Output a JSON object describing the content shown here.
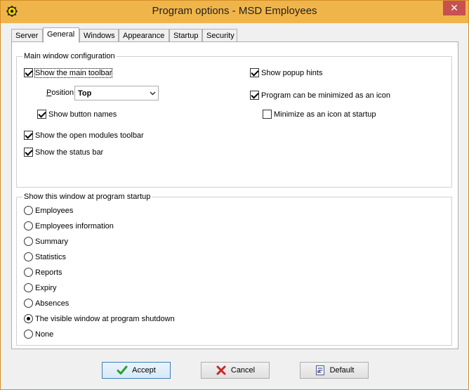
{
  "window": {
    "title": "Program options - MSD Employees",
    "close_glyph": "✕"
  },
  "tabs": [
    {
      "label": "Server",
      "active": false
    },
    {
      "label": "General",
      "active": true
    },
    {
      "label": "Windows",
      "active": false
    },
    {
      "label": "Appearance",
      "active": false
    },
    {
      "label": "Startup",
      "active": false
    },
    {
      "label": "Security",
      "active": false
    }
  ],
  "main_config": {
    "legend": "Main window configuration",
    "show_main_toolbar": {
      "label": "Show the main toolbar",
      "checked": true
    },
    "position": {
      "label": "Position",
      "value": "Top"
    },
    "show_button_names": {
      "label": "Show button names",
      "checked": true
    },
    "show_open_modules_toolbar": {
      "label": "Show the open modules toolbar",
      "checked": true
    },
    "show_status_bar": {
      "label": "Show the status bar",
      "checked": true
    },
    "show_popup_hints": {
      "label": "Show popup hints",
      "checked": true
    },
    "minimizable_as_icon": {
      "label": "Program can be minimized as an icon",
      "checked": true
    },
    "minimize_at_startup": {
      "label": "Minimize as an icon at startup",
      "checked": false
    }
  },
  "startup_window": {
    "legend": "Show this window at program startup",
    "options": [
      {
        "label": "Employees",
        "checked": false
      },
      {
        "label": "Employees information",
        "checked": false
      },
      {
        "label": "Summary",
        "checked": false
      },
      {
        "label": "Statistics",
        "checked": false
      },
      {
        "label": "Reports",
        "checked": false
      },
      {
        "label": "Expiry",
        "checked": false
      },
      {
        "label": "Absences",
        "checked": false
      },
      {
        "label": "The visible window at program shutdown",
        "checked": true
      },
      {
        "label": "None",
        "checked": false
      }
    ]
  },
  "buttons": {
    "accept": "Accept",
    "cancel": "Cancel",
    "default": "Default"
  },
  "colors": {
    "titlebar": "#f0b54a",
    "close_button": "#c75050",
    "accept_icon": "#2e9e2e",
    "cancel_icon": "#c62828"
  }
}
